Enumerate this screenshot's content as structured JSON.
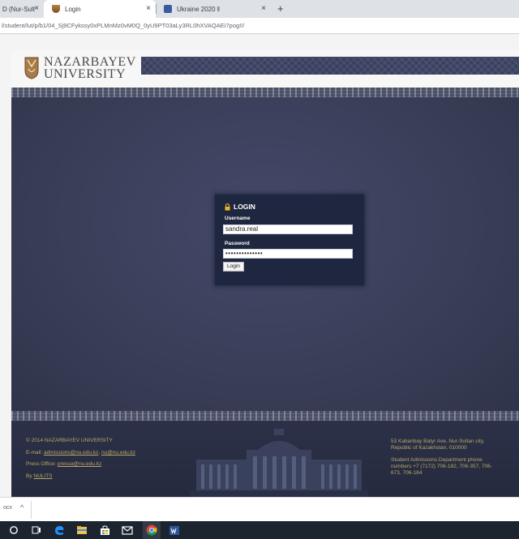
{
  "browser": {
    "tabs": [
      {
        "label": "D (Nur-Sult",
        "close": "×"
      },
      {
        "label": "Login",
        "close": "×"
      },
      {
        "label": "Ukraine 2020 ‖",
        "close": "×"
      }
    ],
    "new_tab": "+",
    "url": "l/student/lut/p/b1/04_Sj9CFykssy0xPLMnMz0vM0Q_0yU9PT03aLy3RL0hXVAQAEi7pogI!/"
  },
  "brand": {
    "line1": "NAZARBAYEV",
    "line2": "UNIVERSITY"
  },
  "login": {
    "title": "LOGIN",
    "username_label": "Username",
    "username_value": "sandra.real",
    "password_label": "Password",
    "password_value": "••••••••••••••",
    "button_label": "Login"
  },
  "footer": {
    "copyright": "© 2014 NAZARBAYEV UNIVERSITY",
    "email_prefix": "E-mail: ",
    "email_1": "admissions@nu.edu.kz",
    "email_sep": ", ",
    "email_2": "nu@nu.edu.kz",
    "press_prefix": "Press Office: ",
    "press_email": "pressa@nu.edu.kz",
    "by_prefix": "By ",
    "by_link": "NULITS",
    "address_1": "53 Kabanbay Batyr Ave, Nur-Sultan city,",
    "address_2": "Republic of Kazakhstan, 010000",
    "phones_1": "Student Admissions Department phone",
    "phones_2": "numbers +7 (7172) 706-182, 706-357, 706-",
    "phones_3": "673, 706-184"
  },
  "download_bar": {
    "item": "ocx",
    "chevron": "^"
  },
  "colors": {
    "frame_bg": "#363a4f",
    "login_bg": "#1f2740",
    "footer_text": "#b8a766"
  }
}
